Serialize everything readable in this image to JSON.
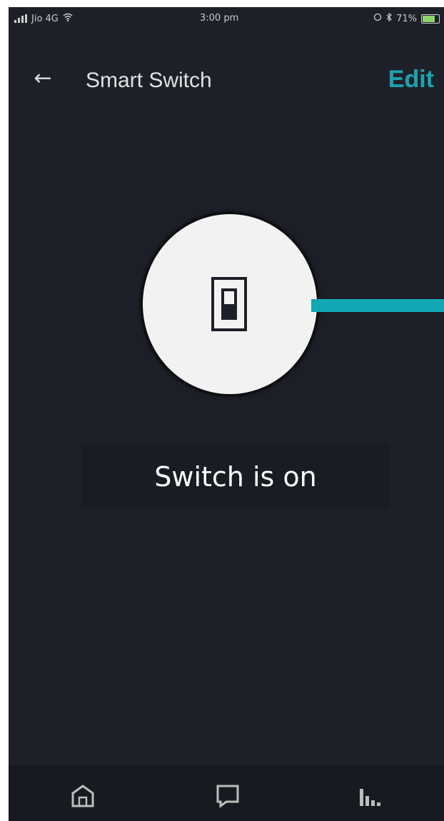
{
  "status_bar": {
    "carrier": "Jio 4G",
    "time": "3:00 pm",
    "battery_percent": "71%"
  },
  "header": {
    "title": "Smart Switch",
    "edit_label": "Edit"
  },
  "device": {
    "status_text": "Switch is on",
    "is_on": true
  },
  "colors": {
    "background": "#1e2029",
    "accent": "#10a8b6",
    "circle": "#f2f2f2"
  },
  "bottom_nav": {
    "items": [
      {
        "icon": "home-icon"
      },
      {
        "icon": "chat-icon"
      },
      {
        "icon": "stats-icon"
      }
    ]
  }
}
